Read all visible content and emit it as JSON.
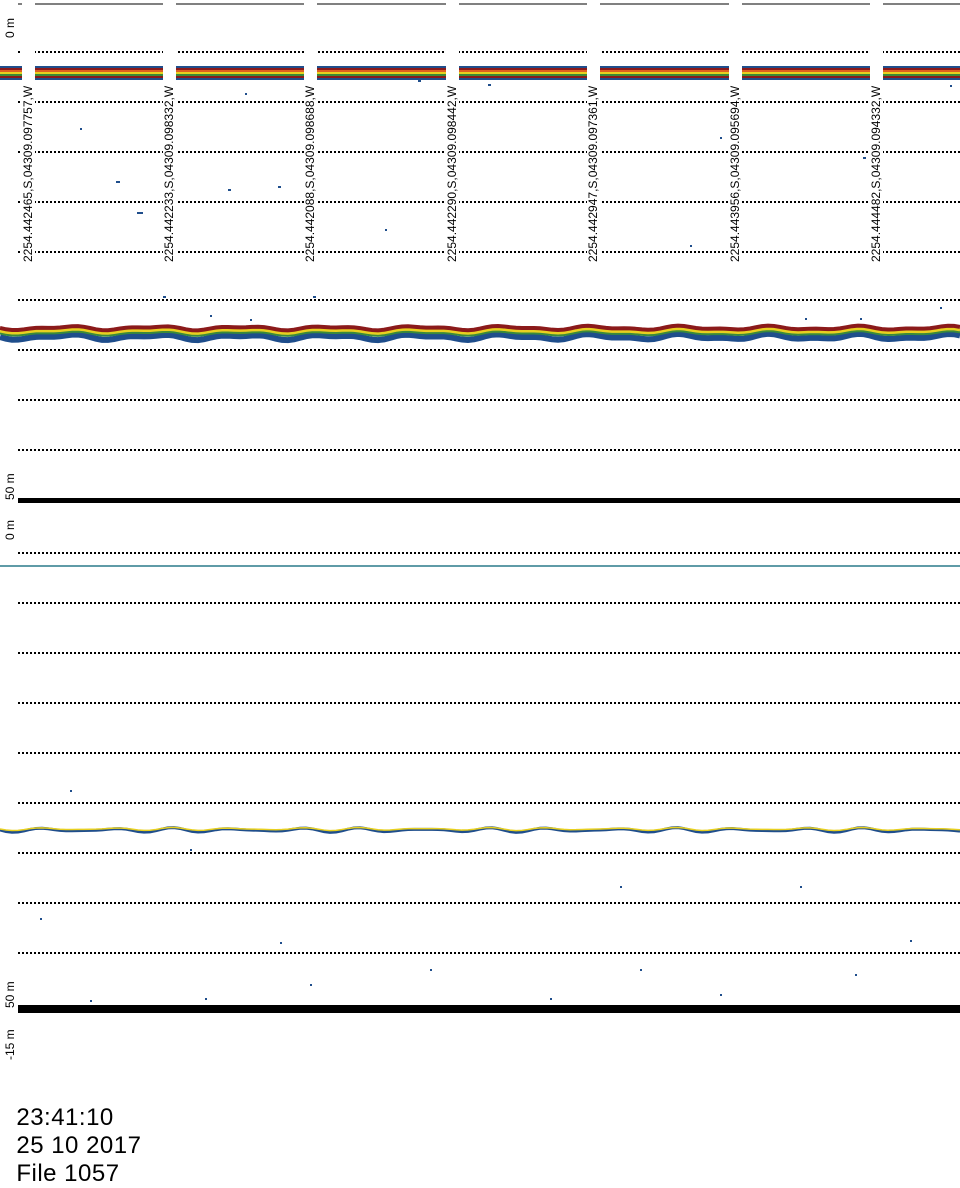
{
  "echogram": {
    "panels": [
      {
        "name": "upper",
        "depth_top_label": "0  m",
        "depth_bottom_label": "50  m",
        "pings": [
          "2254.442465,S,04309.097757,W",
          "2254.442233,S,04309.098332,W",
          "2254.442088,S,04309.098688,W",
          "2254.442290,S,04309.098442,W",
          "2254.442947,S,04309.097361,W",
          "2254.443956,S,04309.095694,W",
          "2254.444482,S,04309.094332,W"
        ]
      },
      {
        "name": "lower",
        "depth_top_label": "0  m",
        "depth_bottom_label": "50  m",
        "extra_label": "-15  m"
      }
    ],
    "colors": {
      "background": "#ffffff",
      "grid": "#000000",
      "echo_red": "#8b1a1a",
      "echo_orange": "#e06020",
      "echo_yellow": "#e8d020",
      "echo_green": "#3a8a3a",
      "echo_blue": "#1f4e8c",
      "echo_teal": "#2a7a8a"
    }
  },
  "footer": {
    "time": "23:41:10",
    "date": "25 10 2017",
    "file": "File 1057"
  }
}
